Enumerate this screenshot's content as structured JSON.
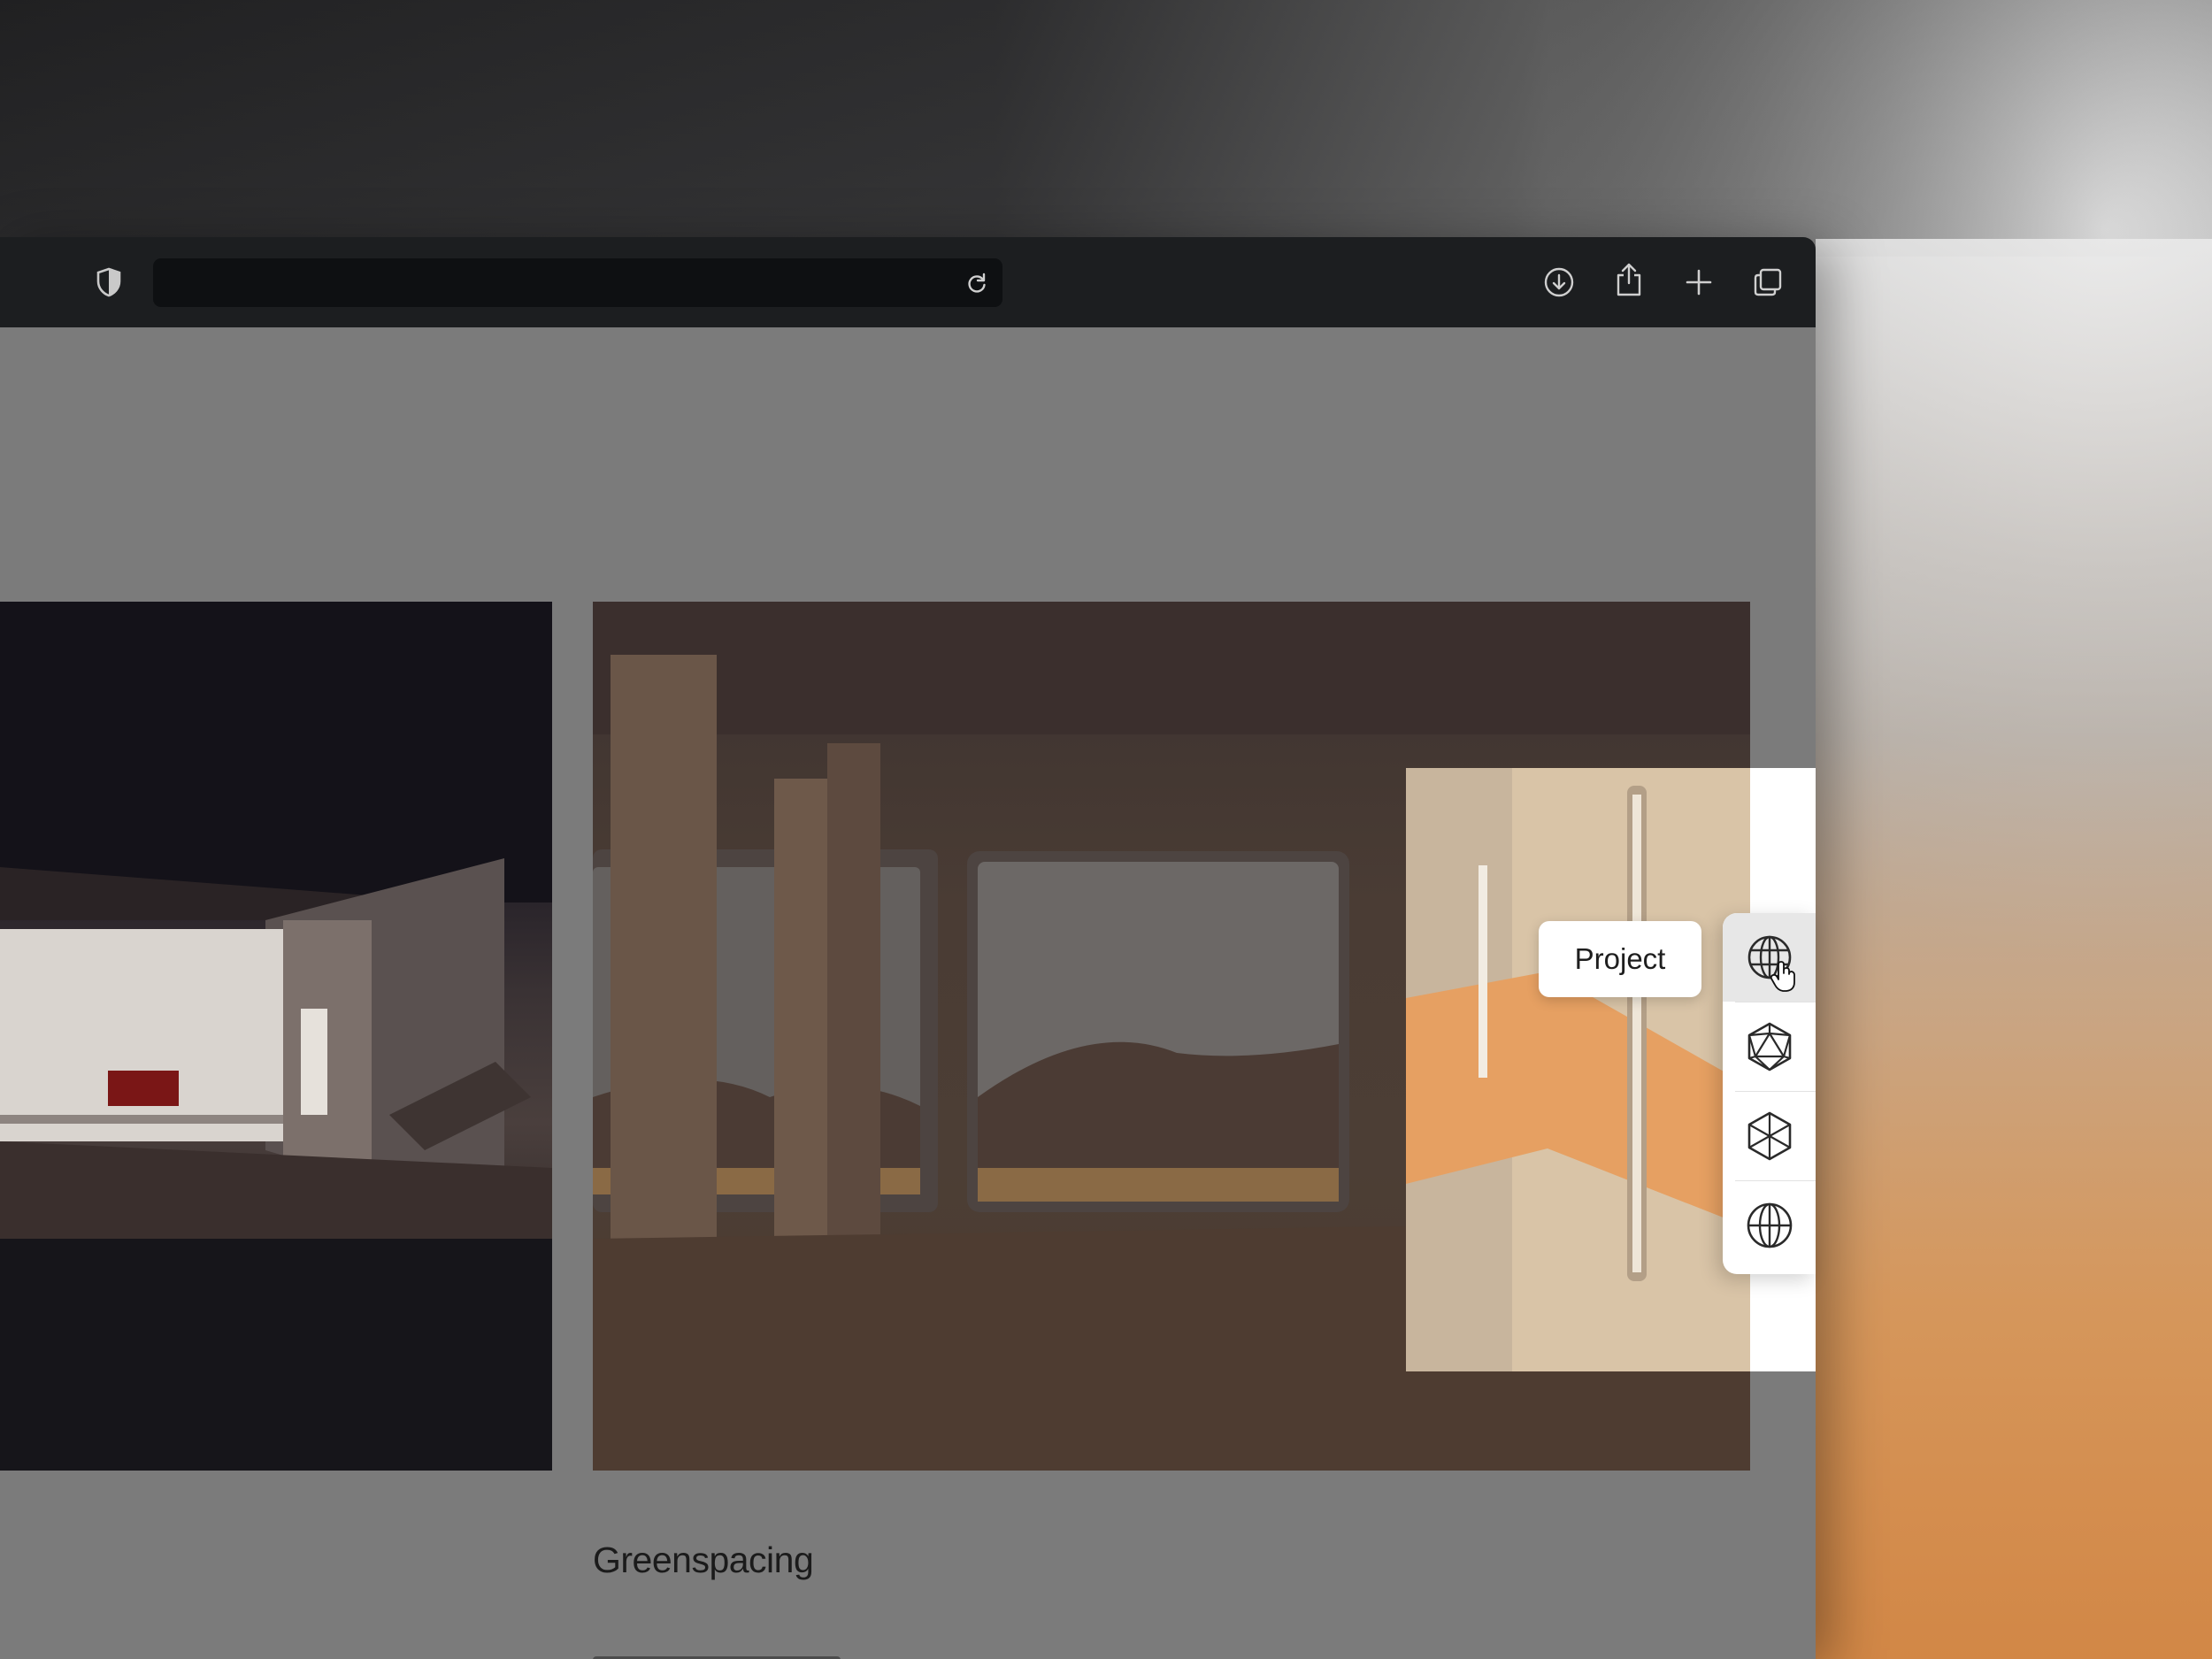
{
  "browser": {
    "address": "",
    "toolbar_icons": [
      "shield-icon",
      "reload-icon",
      "download-icon",
      "share-icon",
      "new-tab-icon",
      "tabs-overview-icon"
    ]
  },
  "project": {
    "title": "Greenspacing"
  },
  "extension": {
    "tooltip_label": "Project",
    "tools": [
      {
        "icon": "globe-icon",
        "active": true
      },
      {
        "icon": "icosahedron-icon",
        "active": false
      },
      {
        "icon": "cube-icon",
        "active": false
      },
      {
        "icon": "world-icon",
        "active": false
      }
    ]
  },
  "colors": {
    "toolbar": "#1c1e20",
    "page_overlay": "#7b7b7b",
    "panel": "#ffffff",
    "accent_warm": "#e4a766"
  }
}
